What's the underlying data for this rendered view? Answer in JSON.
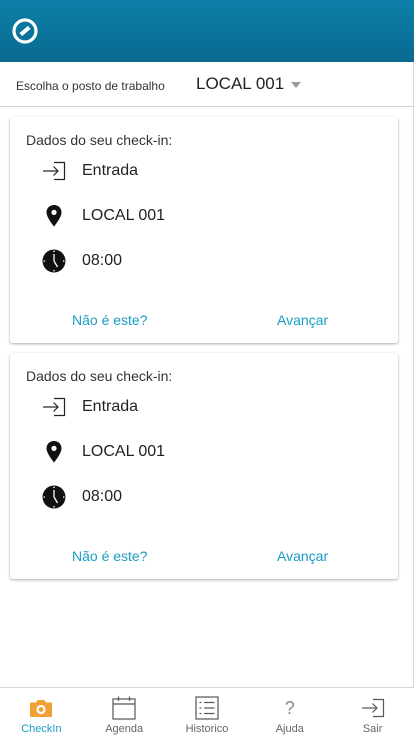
{
  "header": {
    "logo_icon": "app-logo-icon",
    "color": "#0b78a0"
  },
  "selector": {
    "label": "Escolha o posto de trabalho",
    "value": "LOCAL 001"
  },
  "cards": [
    {
      "title": "Dados do seu check-in:",
      "type": "Entrada",
      "location": "LOCAL 001",
      "time": "08:00",
      "reject_label": "Não é este?",
      "confirm_label": "Avançar"
    },
    {
      "title": "Dados do seu check-in:",
      "type": "Entrada",
      "location": "LOCAL 001",
      "time": "08:00",
      "reject_label": "Não é este?",
      "confirm_label": "Avançar"
    }
  ],
  "nav": {
    "items": [
      {
        "label": "CheckIn",
        "icon": "camera-icon",
        "active": true
      },
      {
        "label": "Agenda",
        "icon": "calendar-icon",
        "active": false
      },
      {
        "label": "Historico",
        "icon": "list-icon",
        "active": false
      },
      {
        "label": "Ajuda",
        "icon": "help-icon",
        "active": false
      },
      {
        "label": "Sair",
        "icon": "logout-icon",
        "active": false
      }
    ],
    "help_glyph": "?"
  },
  "colors": {
    "accent": "#1a9cc4",
    "active_icon": "#f0a035",
    "header": "#0b78a0"
  }
}
